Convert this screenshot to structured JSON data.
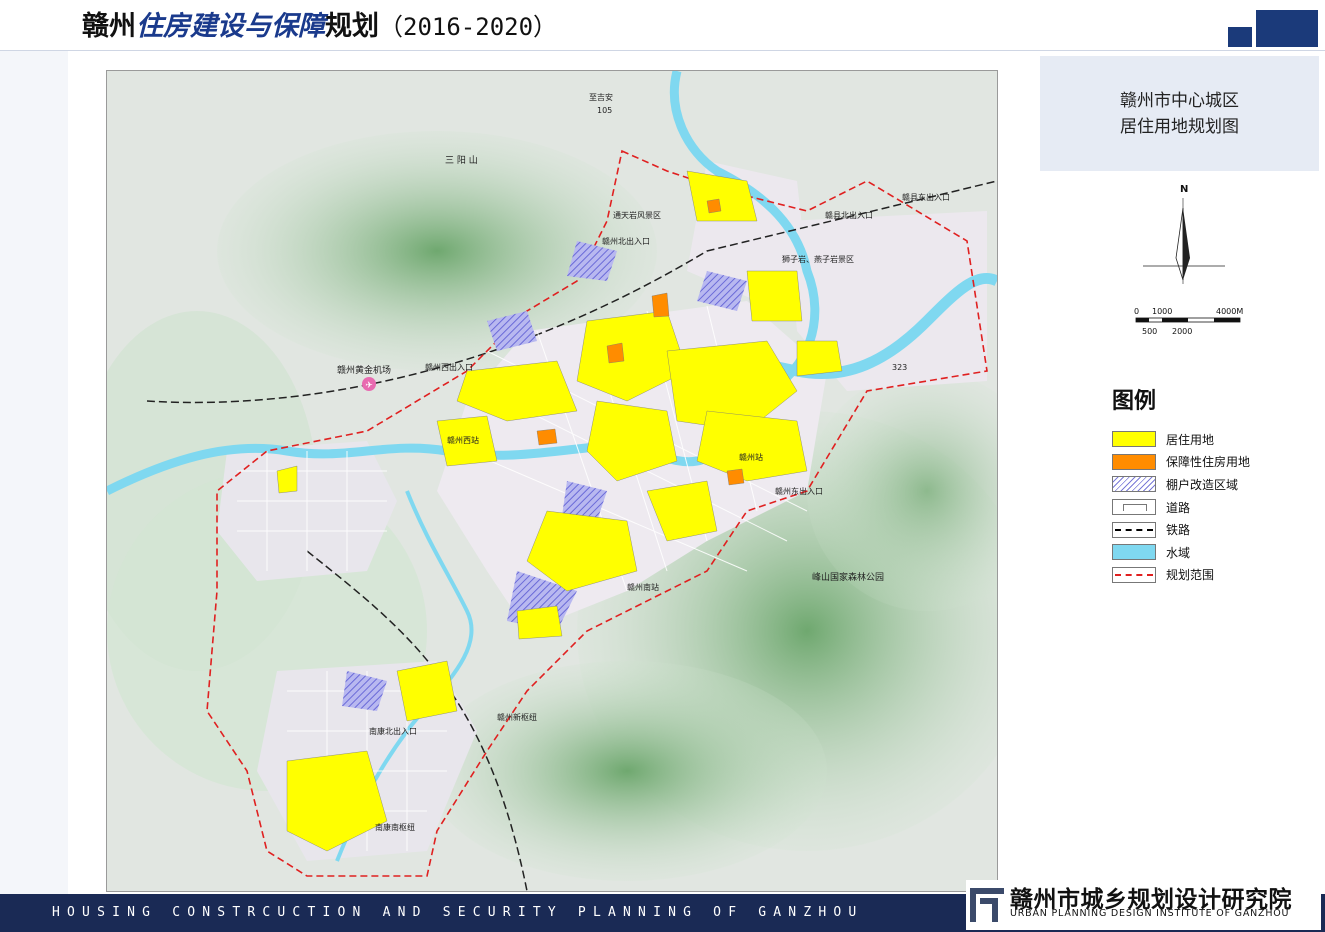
{
  "header": {
    "title_prefix": "赣州",
    "title_highlight": "住房建设与保障",
    "title_suffix": "规划",
    "title_years": "（2016-2020）"
  },
  "map_title": {
    "line1": "赣州市中心城区",
    "line2": "居住用地规划图"
  },
  "compass": {
    "label": "N"
  },
  "scale_bar": {
    "top": [
      "0",
      "1000",
      "4000M"
    ],
    "bottom": [
      "500",
      "2000"
    ]
  },
  "legend": {
    "title": "图例",
    "items": [
      {
        "label": "居住用地",
        "color": "#ffff00",
        "pattern": "fill"
      },
      {
        "label": "保障性住房用地",
        "color": "#ff8c00",
        "pattern": "fill"
      },
      {
        "label": "棚户改造区域",
        "color": "#9a9ae6",
        "pattern": "hatch"
      },
      {
        "label": "道路",
        "color": "#ffffff",
        "pattern": "road"
      },
      {
        "label": "铁路",
        "color": "#000000",
        "pattern": "rail"
      },
      {
        "label": "水域",
        "color": "#7fd8f0",
        "pattern": "fill"
      },
      {
        "label": "规划范围",
        "color": "#e02020",
        "pattern": "dash"
      }
    ]
  },
  "map_labels": {
    "l1": "三 阳 山",
    "l2": "赣州黄金机场",
    "l3": "赣州西出入口",
    "l4": "赣州北出入口",
    "l5": "赣州东出入口",
    "l6": "赣县东出入口",
    "l7": "峰山国家森林公园",
    "l8": "赣州南站",
    "l9": "赣州站",
    "l10": "赣州西站",
    "l11": "南康北出入口",
    "l12": "南康南枢纽",
    "l13": "赣县北出入口",
    "l14": "至吉安",
    "l15": "狮子岩、燕子岩景区",
    "l16": "通天岩风景区",
    "l17": "赣州新枢纽",
    "l18": "105",
    "l19": "323"
  },
  "footer": {
    "tagline": "HOUSING CONSTRCUCTION AND SECURITY PLANNING OF GANZHOU",
    "institute_cn": "赣州市城乡规划设计研究院",
    "institute_en": "URBAN PLANNING DESIGN INSTITUTE OF GANZHOU"
  },
  "colors": {
    "navy": "#1b3a7a",
    "residential": "#ffff00",
    "affordable": "#ff8c00",
    "shantytown": "#9a9ae6",
    "water": "#7fd8f0",
    "boundary": "#e02020",
    "forest": "#8fbf8f"
  }
}
